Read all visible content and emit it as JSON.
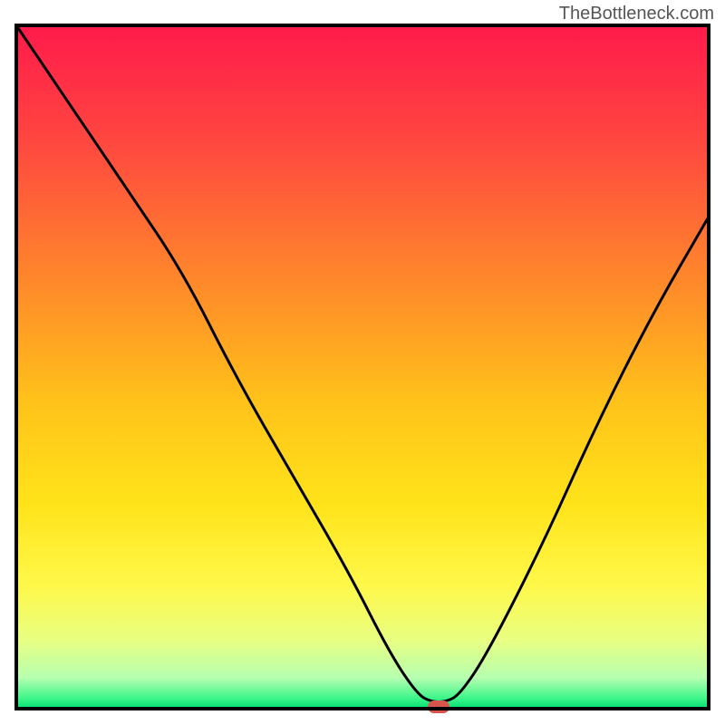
{
  "watermark": "TheBottleneck.com",
  "chart_data": {
    "type": "line",
    "title": "",
    "xlabel": "",
    "ylabel": "",
    "xlim": [
      0,
      100
    ],
    "ylim": [
      0,
      100
    ],
    "series": [
      {
        "name": "bottleneck-curve",
        "x": [
          0,
          8,
          16,
          24,
          32,
          40,
          48,
          54,
          58,
          60,
          62,
          64,
          68,
          76,
          84,
          92,
          100
        ],
        "y": [
          100,
          88,
          76,
          64,
          48,
          34,
          20,
          8,
          2,
          1,
          1,
          2,
          8,
          24,
          42,
          58,
          72
        ]
      }
    ],
    "marker": {
      "x": 61,
      "y": 0,
      "color": "#d9544d"
    },
    "gradient_stops": [
      {
        "offset": 0.0,
        "color": "#ff1a4b"
      },
      {
        "offset": 0.18,
        "color": "#ff4a3f"
      },
      {
        "offset": 0.38,
        "color": "#ff8a2a"
      },
      {
        "offset": 0.55,
        "color": "#ffc21a"
      },
      {
        "offset": 0.7,
        "color": "#ffe31a"
      },
      {
        "offset": 0.82,
        "color": "#fff84a"
      },
      {
        "offset": 0.9,
        "color": "#e8ff82"
      },
      {
        "offset": 0.955,
        "color": "#b6ffb0"
      },
      {
        "offset": 0.985,
        "color": "#3df58a"
      },
      {
        "offset": 1.0,
        "color": "#00e070"
      }
    ],
    "frame": {
      "stroke": "#000000",
      "stroke_width": 4
    },
    "curve_style": {
      "stroke": "#000000",
      "stroke_width": 3
    }
  }
}
